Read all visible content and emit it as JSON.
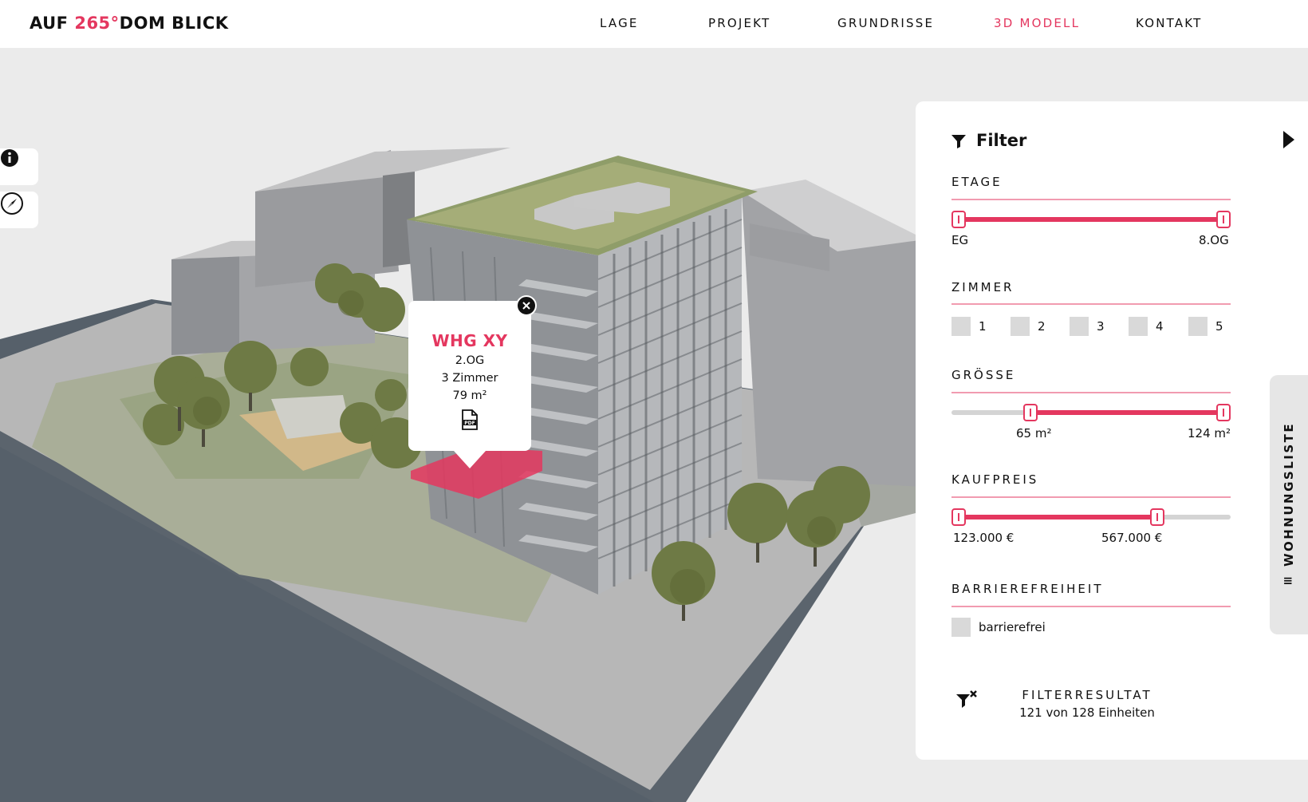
{
  "header": {
    "logo_prefix": "AUF ",
    "logo_accent": "265°",
    "logo_suffix": "DOM BLICK",
    "nav": [
      {
        "label": "LAGE",
        "active": false
      },
      {
        "label": "PROJEKT",
        "active": false
      },
      {
        "label": "GRUNDRISSE",
        "active": false
      },
      {
        "label": "3D MODELL",
        "active": true
      },
      {
        "label": "KONTAKT",
        "active": false
      }
    ]
  },
  "tools": {
    "info_icon": "info-icon",
    "compass_icon": "compass-icon"
  },
  "popup": {
    "title": "WHG XY",
    "floor": "2.OG",
    "rooms": "3 Zimmer",
    "area": "79 m²",
    "pdf_icon": "pdf-icon",
    "close_icon": "close-icon"
  },
  "filter": {
    "title": "Filter",
    "collapse_icon": "play-triangle-icon",
    "etage": {
      "label": "ETAGE",
      "min_label": "EG",
      "max_label": "8.OG",
      "min_fraction": 0.0,
      "max_fraction": 1.0
    },
    "zimmer": {
      "label": "ZIMMER",
      "options": [
        "1",
        "2",
        "3",
        "4",
        "5"
      ]
    },
    "groesse": {
      "label": "GRÖSSE",
      "min_label": "65 m²",
      "max_label": "124 m²",
      "min_fraction": 0.27,
      "max_fraction": 1.0
    },
    "kaufpreis": {
      "label": "KAUFPREIS",
      "min_label": "123.000 €",
      "max_label": "567.000 €",
      "min_fraction": 0.0,
      "max_fraction": 0.75
    },
    "barrierefreiheit": {
      "label": "BARRIEREFREIHEIT",
      "option": "barrierefrei"
    },
    "result": {
      "title": "FILTERRESULTAT",
      "count": "121 von 128 Einheiten",
      "icon": "filter-reset-icon"
    }
  },
  "side_tab": {
    "label": "WOHNUNGSLISTE",
    "icon": "list-icon"
  },
  "colors": {
    "accent": "#e4375f",
    "accent_light": "#f19bb0",
    "background": "#ebebeb"
  }
}
